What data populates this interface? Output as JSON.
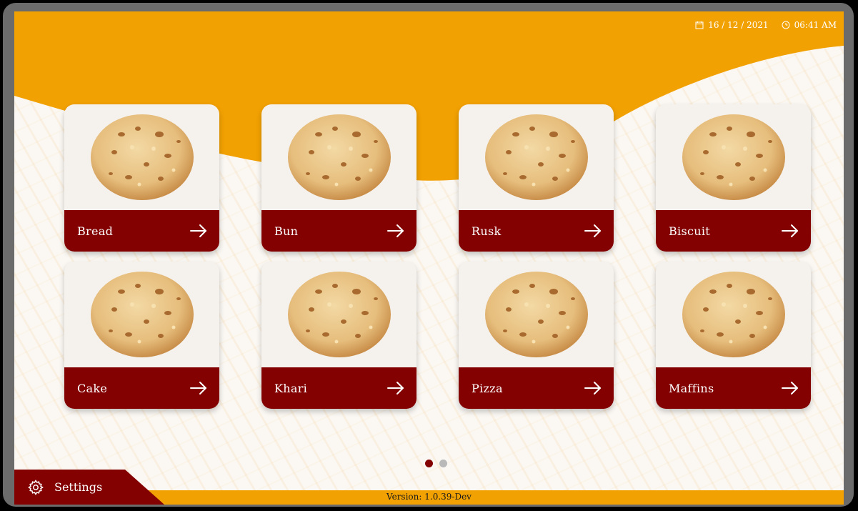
{
  "header": {
    "date": "16 / 12 / 2021",
    "time": "06:41 AM",
    "date_icon": "calendar-icon",
    "time_icon": "clock-icon"
  },
  "colors": {
    "accent_orange": "#f2a102",
    "card_footer": "#830101",
    "background": "#fbf8f4"
  },
  "categories": [
    {
      "label": "Bread",
      "image": "cookie-image",
      "icon": "arrow-right-icon"
    },
    {
      "label": "Bun",
      "image": "cookie-image",
      "icon": "arrow-right-icon"
    },
    {
      "label": "Rusk",
      "image": "cookie-image",
      "icon": "arrow-right-icon"
    },
    {
      "label": "Biscuit",
      "image": "cookie-image",
      "icon": "arrow-right-icon"
    },
    {
      "label": "Cake",
      "image": "cookie-image",
      "icon": "arrow-right-icon"
    },
    {
      "label": "Khari",
      "image": "cookie-image",
      "icon": "arrow-right-icon"
    },
    {
      "label": "Pizza",
      "image": "cookie-image",
      "icon": "arrow-right-icon"
    },
    {
      "label": "Maffins",
      "image": "cookie-image",
      "icon": "arrow-right-icon"
    }
  ],
  "pagination": {
    "pages": 2,
    "current": 1
  },
  "footer": {
    "settings_label": "Settings",
    "settings_icon": "gear-icon",
    "version": "Version: 1.0.39-Dev"
  }
}
